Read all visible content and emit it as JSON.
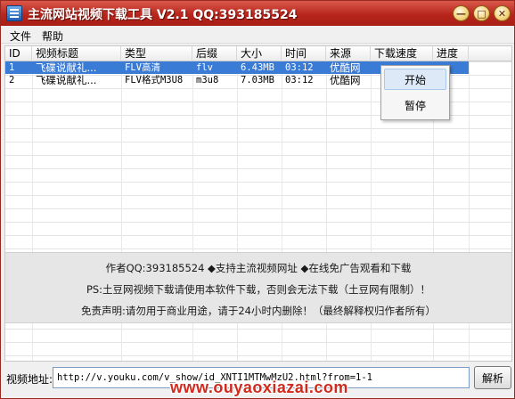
{
  "window": {
    "title": "主流网站视频下载工具 V2.1  QQ:393185524",
    "min_label": "—",
    "max_label": "□",
    "close_label": "✕"
  },
  "menu": {
    "file": "文件",
    "help": "帮助"
  },
  "table": {
    "columns": [
      "ID",
      "视频标题",
      "类型",
      "后缀",
      "大小",
      "时间",
      "来源",
      "下载速度",
      "进度"
    ],
    "rows": [
      {
        "id": "1",
        "title": "飞碟说献礼...",
        "type": "FLV高清",
        "ext": "flv",
        "size": "6.43MB",
        "time": "03:12",
        "source": "优酷网",
        "speed": "",
        "progress": "",
        "selected": true
      },
      {
        "id": "2",
        "title": "飞碟说献礼...",
        "type": "FLV格式M3U8",
        "ext": "m3u8",
        "size": "7.03MB",
        "time": "03:12",
        "source": "优酷网",
        "speed": "",
        "progress": "",
        "selected": false
      }
    ]
  },
  "context_menu": {
    "start": "开始",
    "pause": "暂停"
  },
  "info": {
    "line1": "作者QQ:393185524  ◆支持主流视频网址 ◆在线免广告观看和下载",
    "line2": "PS:土豆网视频下载请使用本软件下载，否则会无法下载（土豆网有限制）！",
    "line3": "免责声明:请勿用于商业用途，请于24小时内删除！（最终解释权归作者所有）"
  },
  "bottom": {
    "url_label": "视频地址:",
    "url_value": "http://v.youku.com/v_show/id_XNTI1MTMwMzU2.html?from=1-1",
    "parse_button": "解析"
  },
  "watermark": "www.ouyaoxiazai.com",
  "colors": {
    "titlebar": "#b8261c",
    "selection": "#3a7bd5",
    "watermark": "#d12a1c"
  }
}
